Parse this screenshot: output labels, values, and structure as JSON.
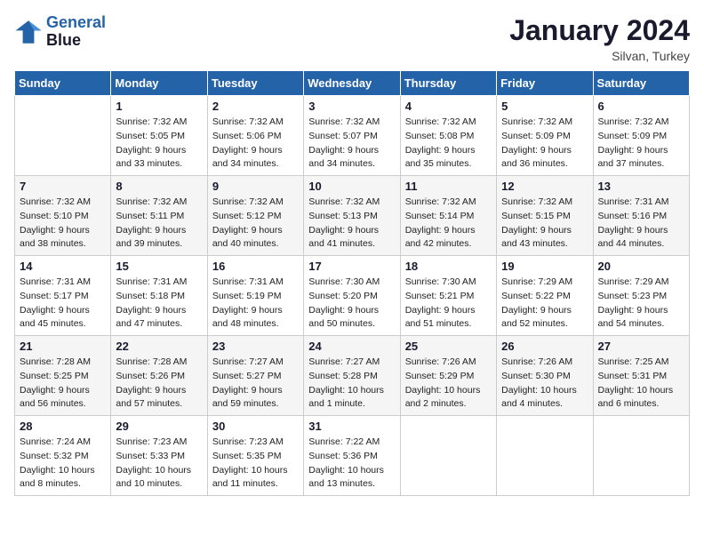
{
  "logo": {
    "line1": "General",
    "line2": "Blue"
  },
  "title": "January 2024",
  "location": "Silvan, Turkey",
  "days_header": [
    "Sunday",
    "Monday",
    "Tuesday",
    "Wednesday",
    "Thursday",
    "Friday",
    "Saturday"
  ],
  "weeks": [
    [
      {
        "num": "",
        "sunrise": "",
        "sunset": "",
        "daylight": ""
      },
      {
        "num": "1",
        "sunrise": "Sunrise: 7:32 AM",
        "sunset": "Sunset: 5:05 PM",
        "daylight": "Daylight: 9 hours and 33 minutes."
      },
      {
        "num": "2",
        "sunrise": "Sunrise: 7:32 AM",
        "sunset": "Sunset: 5:06 PM",
        "daylight": "Daylight: 9 hours and 34 minutes."
      },
      {
        "num": "3",
        "sunrise": "Sunrise: 7:32 AM",
        "sunset": "Sunset: 5:07 PM",
        "daylight": "Daylight: 9 hours and 34 minutes."
      },
      {
        "num": "4",
        "sunrise": "Sunrise: 7:32 AM",
        "sunset": "Sunset: 5:08 PM",
        "daylight": "Daylight: 9 hours and 35 minutes."
      },
      {
        "num": "5",
        "sunrise": "Sunrise: 7:32 AM",
        "sunset": "Sunset: 5:09 PM",
        "daylight": "Daylight: 9 hours and 36 minutes."
      },
      {
        "num": "6",
        "sunrise": "Sunrise: 7:32 AM",
        "sunset": "Sunset: 5:09 PM",
        "daylight": "Daylight: 9 hours and 37 minutes."
      }
    ],
    [
      {
        "num": "7",
        "sunrise": "Sunrise: 7:32 AM",
        "sunset": "Sunset: 5:10 PM",
        "daylight": "Daylight: 9 hours and 38 minutes."
      },
      {
        "num": "8",
        "sunrise": "Sunrise: 7:32 AM",
        "sunset": "Sunset: 5:11 PM",
        "daylight": "Daylight: 9 hours and 39 minutes."
      },
      {
        "num": "9",
        "sunrise": "Sunrise: 7:32 AM",
        "sunset": "Sunset: 5:12 PM",
        "daylight": "Daylight: 9 hours and 40 minutes."
      },
      {
        "num": "10",
        "sunrise": "Sunrise: 7:32 AM",
        "sunset": "Sunset: 5:13 PM",
        "daylight": "Daylight: 9 hours and 41 minutes."
      },
      {
        "num": "11",
        "sunrise": "Sunrise: 7:32 AM",
        "sunset": "Sunset: 5:14 PM",
        "daylight": "Daylight: 9 hours and 42 minutes."
      },
      {
        "num": "12",
        "sunrise": "Sunrise: 7:32 AM",
        "sunset": "Sunset: 5:15 PM",
        "daylight": "Daylight: 9 hours and 43 minutes."
      },
      {
        "num": "13",
        "sunrise": "Sunrise: 7:31 AM",
        "sunset": "Sunset: 5:16 PM",
        "daylight": "Daylight: 9 hours and 44 minutes."
      }
    ],
    [
      {
        "num": "14",
        "sunrise": "Sunrise: 7:31 AM",
        "sunset": "Sunset: 5:17 PM",
        "daylight": "Daylight: 9 hours and 45 minutes."
      },
      {
        "num": "15",
        "sunrise": "Sunrise: 7:31 AM",
        "sunset": "Sunset: 5:18 PM",
        "daylight": "Daylight: 9 hours and 47 minutes."
      },
      {
        "num": "16",
        "sunrise": "Sunrise: 7:31 AM",
        "sunset": "Sunset: 5:19 PM",
        "daylight": "Daylight: 9 hours and 48 minutes."
      },
      {
        "num": "17",
        "sunrise": "Sunrise: 7:30 AM",
        "sunset": "Sunset: 5:20 PM",
        "daylight": "Daylight: 9 hours and 50 minutes."
      },
      {
        "num": "18",
        "sunrise": "Sunrise: 7:30 AM",
        "sunset": "Sunset: 5:21 PM",
        "daylight": "Daylight: 9 hours and 51 minutes."
      },
      {
        "num": "19",
        "sunrise": "Sunrise: 7:29 AM",
        "sunset": "Sunset: 5:22 PM",
        "daylight": "Daylight: 9 hours and 52 minutes."
      },
      {
        "num": "20",
        "sunrise": "Sunrise: 7:29 AM",
        "sunset": "Sunset: 5:23 PM",
        "daylight": "Daylight: 9 hours and 54 minutes."
      }
    ],
    [
      {
        "num": "21",
        "sunrise": "Sunrise: 7:28 AM",
        "sunset": "Sunset: 5:25 PM",
        "daylight": "Daylight: 9 hours and 56 minutes."
      },
      {
        "num": "22",
        "sunrise": "Sunrise: 7:28 AM",
        "sunset": "Sunset: 5:26 PM",
        "daylight": "Daylight: 9 hours and 57 minutes."
      },
      {
        "num": "23",
        "sunrise": "Sunrise: 7:27 AM",
        "sunset": "Sunset: 5:27 PM",
        "daylight": "Daylight: 9 hours and 59 minutes."
      },
      {
        "num": "24",
        "sunrise": "Sunrise: 7:27 AM",
        "sunset": "Sunset: 5:28 PM",
        "daylight": "Daylight: 10 hours and 1 minute."
      },
      {
        "num": "25",
        "sunrise": "Sunrise: 7:26 AM",
        "sunset": "Sunset: 5:29 PM",
        "daylight": "Daylight: 10 hours and 2 minutes."
      },
      {
        "num": "26",
        "sunrise": "Sunrise: 7:26 AM",
        "sunset": "Sunset: 5:30 PM",
        "daylight": "Daylight: 10 hours and 4 minutes."
      },
      {
        "num": "27",
        "sunrise": "Sunrise: 7:25 AM",
        "sunset": "Sunset: 5:31 PM",
        "daylight": "Daylight: 10 hours and 6 minutes."
      }
    ],
    [
      {
        "num": "28",
        "sunrise": "Sunrise: 7:24 AM",
        "sunset": "Sunset: 5:32 PM",
        "daylight": "Daylight: 10 hours and 8 minutes."
      },
      {
        "num": "29",
        "sunrise": "Sunrise: 7:23 AM",
        "sunset": "Sunset: 5:33 PM",
        "daylight": "Daylight: 10 hours and 10 minutes."
      },
      {
        "num": "30",
        "sunrise": "Sunrise: 7:23 AM",
        "sunset": "Sunset: 5:35 PM",
        "daylight": "Daylight: 10 hours and 11 minutes."
      },
      {
        "num": "31",
        "sunrise": "Sunrise: 7:22 AM",
        "sunset": "Sunset: 5:36 PM",
        "daylight": "Daylight: 10 hours and 13 minutes."
      },
      {
        "num": "",
        "sunrise": "",
        "sunset": "",
        "daylight": ""
      },
      {
        "num": "",
        "sunrise": "",
        "sunset": "",
        "daylight": ""
      },
      {
        "num": "",
        "sunrise": "",
        "sunset": "",
        "daylight": ""
      }
    ]
  ]
}
